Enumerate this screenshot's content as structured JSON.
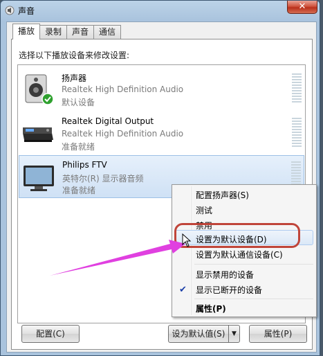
{
  "window": {
    "title": "声音",
    "close_label": "✕"
  },
  "tabs": [
    {
      "label": "播放",
      "active": true
    },
    {
      "label": "录制",
      "active": false
    },
    {
      "label": "声音",
      "active": false
    },
    {
      "label": "通信",
      "active": false
    }
  ],
  "instruction": "选择以下播放设备来修改设置:",
  "devices": [
    {
      "name": "扬声器",
      "subtitle": "Realtek High Definition Audio",
      "status": "默认设备",
      "icon": "speaker-icon",
      "default": true
    },
    {
      "name": "Realtek Digital Output",
      "subtitle": "Realtek High Definition Audio",
      "status": "准备就绪",
      "icon": "digital-output-icon",
      "default": false
    },
    {
      "name": "Philips FTV",
      "subtitle": "英特尔(R) 显示器音频",
      "status": "准备就绪",
      "icon": "monitor-icon",
      "default": false,
      "selected": true
    }
  ],
  "buttons": {
    "configure": "配置(C)",
    "set_default": "设为默认值(S)",
    "properties": "属性(P)"
  },
  "context_menu": {
    "items": [
      "配置扬声器(S)",
      "测试",
      "禁用",
      "设置为默认设备(D)",
      "设置为默认通信设备(C)",
      "显示禁用的设备",
      "显示已断开的设备",
      "属性(P)"
    ],
    "checked_item": "显示已断开的设备",
    "highlighted_item": "设置为默认设备(D)",
    "check_mark": "✔"
  },
  "colors": {
    "highlight_oval": "#c0453a",
    "annotation_arrow": "#e040e0"
  }
}
